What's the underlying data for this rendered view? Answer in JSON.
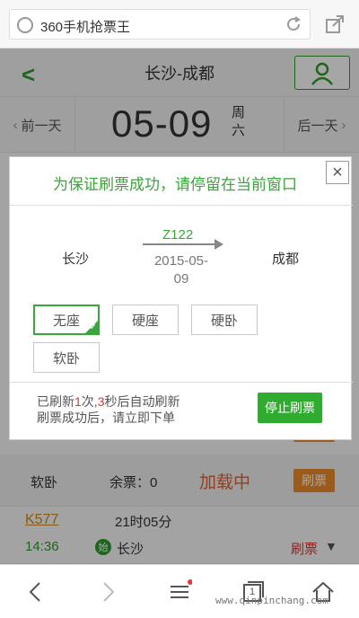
{
  "browser": {
    "url_text": "360手机抢票王"
  },
  "header": {
    "title": "长沙-成都"
  },
  "date_nav": {
    "prev_label": "前一天",
    "next_label": "后一天",
    "date": "05-09",
    "weekday": "周六"
  },
  "seat_row": {
    "name": "软卧",
    "remain": "余票：0",
    "status": "加载中",
    "action": "刷票"
  },
  "train_row": {
    "train_no": "K577",
    "duration": "21时05分",
    "dep_time": "14:36",
    "start_badge": "始",
    "dep_station": "长沙",
    "action": "刷票"
  },
  "dialog": {
    "title": "为保证刷票成功，请停留在当前窗口",
    "close_label": "×",
    "from_station": "长沙",
    "to_station": "成都",
    "train": "Z122",
    "date_line1": "2015-05-",
    "date_line2": "09",
    "seats": [
      {
        "label": "无座",
        "selected": true
      },
      {
        "label": "硬座",
        "selected": false
      },
      {
        "label": "硬卧",
        "selected": false
      },
      {
        "label": "软卧",
        "selected": false
      }
    ],
    "status_prefix": "已刷新",
    "refresh_count": "1",
    "status_mid": "次,",
    "countdown": "3",
    "status_suffix": "秒后自动刷新",
    "status_line2": "刷票成功后，请立即下单",
    "stop_label": "停止刷票"
  },
  "toolbar": {
    "tabs_count": "1",
    "watermark": "www.qinpinchang.com"
  },
  "colors": {
    "accent_green": "#3aa53a",
    "orange": "#ef8d2c",
    "red": "#d33"
  },
  "icons": [
    "globe-icon",
    "reload-icon",
    "share-icon",
    "back-chevron-icon",
    "user-icon",
    "close-icon",
    "menu-icon",
    "tabs-icon",
    "home-icon",
    "forward-chevron-icon"
  ]
}
